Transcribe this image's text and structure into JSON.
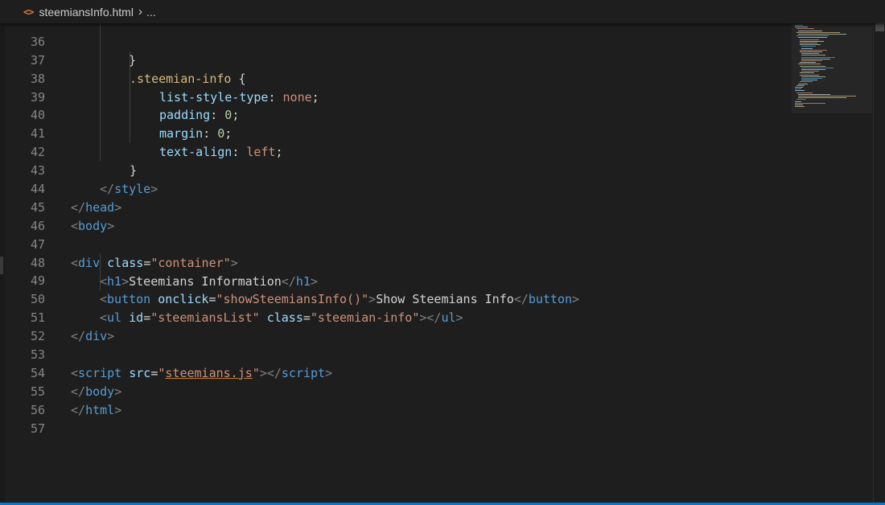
{
  "breadcrumb": {
    "icon": "html-file-icon",
    "filename": "steemiansInfo.html",
    "separator": "›",
    "more": "..."
  },
  "colors": {
    "background": "#1e1e1e",
    "tag": "#569cd6",
    "bracket": "#808080",
    "attribute": "#9cdcfe",
    "string": "#ce9178",
    "selector": "#d7ba7d",
    "number": "#b5cea8",
    "text": "#d4d4d4",
    "line_number": "#858585",
    "status_bar": "#007acc"
  },
  "code": {
    "l36": {
      "n": "36",
      "brace": "}"
    },
    "l37": {
      "n": "37",
      "selector": ".steemian-info",
      "brace": " {"
    },
    "l38": {
      "n": "38",
      "prop": "list-style-type",
      "colon": ": ",
      "value": "none",
      "semi": ";"
    },
    "l39": {
      "n": "39",
      "prop": "padding",
      "colon": ": ",
      "value": "0",
      "semi": ";"
    },
    "l40": {
      "n": "40",
      "prop": "margin",
      "colon": ": ",
      "value": "0",
      "semi": ";"
    },
    "l41": {
      "n": "41",
      "prop": "text-align",
      "colon": ": ",
      "value": "left",
      "semi": ";"
    },
    "l42": {
      "n": "42",
      "brace": "}"
    },
    "l43": {
      "n": "43",
      "open": "</",
      "tag": "style",
      "close": ">"
    },
    "l44": {
      "n": "44",
      "open": "</",
      "tag": "head",
      "close": ">"
    },
    "l45": {
      "n": "45",
      "open": "<",
      "tag": "body",
      "close": ">"
    },
    "l46": {
      "n": "46"
    },
    "l47": {
      "n": "47",
      "open": "<",
      "tag": "div",
      "sp": " ",
      "attr": "class",
      "eq": "=",
      "val": "\"container\"",
      "close": ">"
    },
    "l48": {
      "n": "48",
      "open": "<",
      "tag": "h1",
      "close": ">",
      "text": "Steemians Information",
      "open2": "</",
      "tag2": "h1",
      "close2": ">"
    },
    "l49": {
      "n": "49",
      "open": "<",
      "tag": "button",
      "sp": " ",
      "attr": "onclick",
      "eq": "=",
      "val": "\"showSteemiansInfo()\"",
      "close": ">",
      "text": "Show Steemians Info",
      "open2": "</",
      "tag2": "button",
      "close2": ">"
    },
    "l50": {
      "n": "50",
      "open": "<",
      "tag": "ul",
      "sp": " ",
      "attr": "id",
      "eq": "=",
      "val": "\"steemiansList\"",
      "sp2": " ",
      "attr2": "class",
      "eq2": "=",
      "val2": "\"steemian-info\"",
      "close": ">",
      "open2": "</",
      "tag2": "ul",
      "close2": ">"
    },
    "l51": {
      "n": "51",
      "open": "</",
      "tag": "div",
      "close": ">"
    },
    "l52": {
      "n": "52"
    },
    "l53": {
      "n": "53",
      "open": "<",
      "tag": "script",
      "sp": " ",
      "attr": "src",
      "eq": "=",
      "q1": "\"",
      "src": "steemians.js",
      "q2": "\"",
      "close": ">",
      "open2": "</",
      "tag2": "script",
      "close2": ">"
    },
    "l54": {
      "n": "54",
      "open": "</",
      "tag": "body",
      "close": ">"
    },
    "l55": {
      "n": "55",
      "open": "</",
      "tag": "html",
      "close": ">"
    },
    "l56": {
      "n": "56"
    },
    "l57": {
      "n": "57"
    }
  }
}
